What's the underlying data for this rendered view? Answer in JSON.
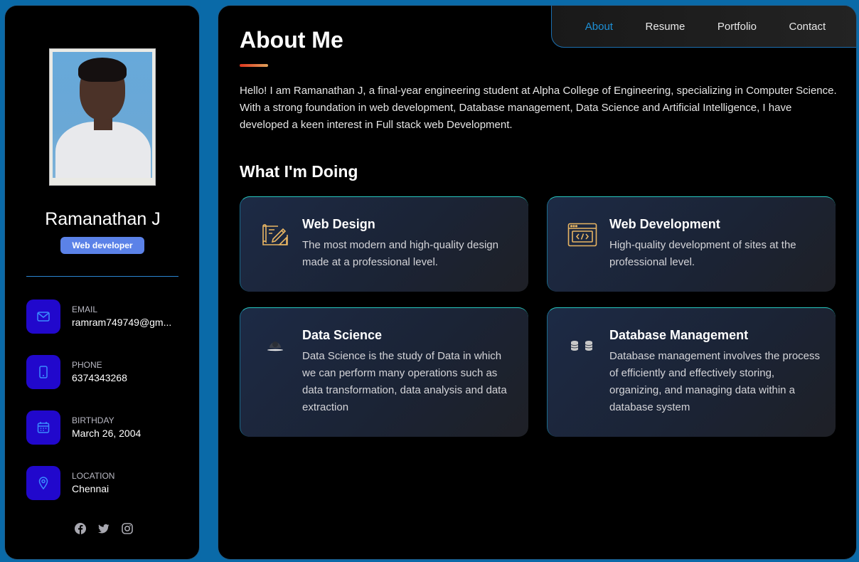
{
  "profile": {
    "name": "Ramanathan J",
    "role": "Web developer"
  },
  "contacts": [
    {
      "label": "EMAIL",
      "value": "ramram749749@gm...",
      "icon": "mail-icon"
    },
    {
      "label": "PHONE",
      "value": "6374343268",
      "icon": "phone-icon"
    },
    {
      "label": "BIRTHDAY",
      "value": "March 26, 2004",
      "icon": "calendar-icon"
    },
    {
      "label": "LOCATION",
      "value": "Chennai",
      "icon": "location-pin-icon"
    }
  ],
  "socials": [
    "facebook-icon",
    "twitter-icon",
    "instagram-icon"
  ],
  "nav": {
    "items": [
      "About",
      "Resume",
      "Portfolio",
      "Contact"
    ],
    "active": "About"
  },
  "about": {
    "title": "About Me",
    "text": "Hello! I am Ramanathan J, a final-year engineering student at Alpha College of Engineering, specializing in Computer Science. With a strong foundation in web development, Database management, Data Science and Artificial Intelligence, I have developed a keen interest in Full stack web Development."
  },
  "services": {
    "title": "What I'm Doing",
    "items": [
      {
        "title": "Web Design",
        "text": "The most modern and high-quality design made at a professional level.",
        "icon": "design-icon"
      },
      {
        "title": "Web Development",
        "text": "High-quality development of sites at the professional level.",
        "icon": "code-window-icon"
      },
      {
        "title": "Data Science",
        "text": "Data Science is the study of Data in which we can perform many operations such as data transformation, data analysis and data extraction",
        "icon": "data-science-icon"
      },
      {
        "title": "Database Management",
        "text": "Database management involves the process of efficiently and effectively storing, organizing, and managing data within a database system",
        "icon": "database-icon"
      }
    ]
  },
  "colors": {
    "accent": "#1e90d6",
    "icon_bg": "#2108cc",
    "badge": "#5b82e8",
    "gold": "#e8b563"
  }
}
